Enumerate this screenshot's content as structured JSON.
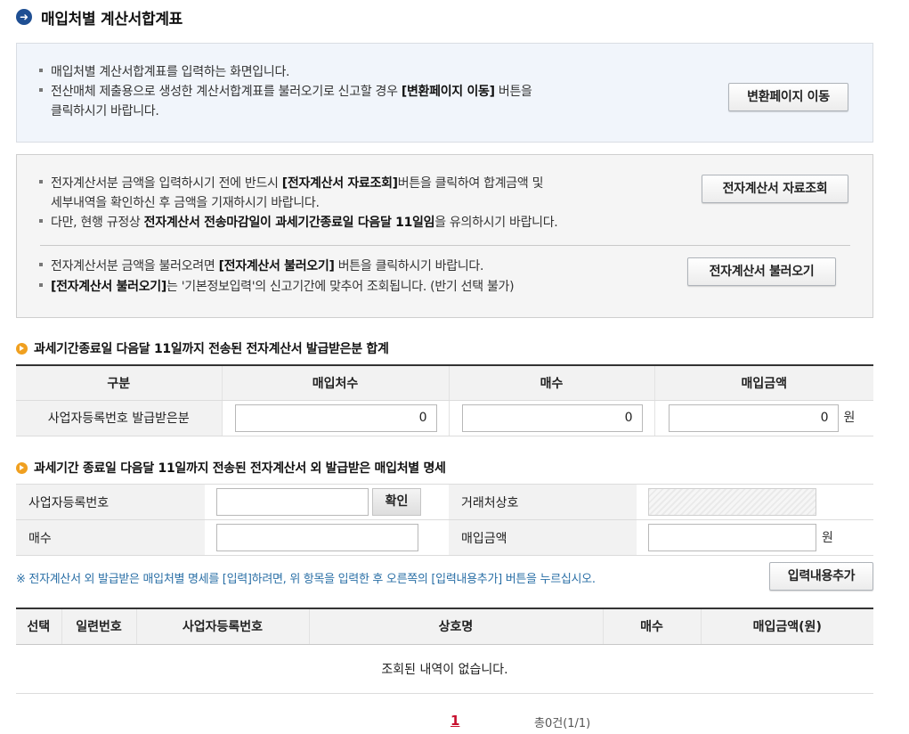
{
  "page": {
    "title": "매입처별 계산서합계표"
  },
  "box1": {
    "line1": "매입처별 계산서합계표를 입력하는 화면입니다.",
    "line2_pre": "전산매체 제출용으로 생성한 계산서합계표를 불러오기로 신고할 경우 ",
    "line2_bold": "[변환페이지 이동]",
    "line2_post": " 버튼을",
    "line3": "클릭하시기 바랍니다.",
    "button": "변환페이지 이동"
  },
  "box2": {
    "line1_pre": "전자계산서분 금액을 입력하시기 전에 반드시 ",
    "line1_bold": "[전자계산서 자료조회]",
    "line1_post": "버튼을 클릭하여 합계금액 및",
    "line2": "세부내역을 확인하신 후 금액을 기재하시기 바랍니다.",
    "line3_pre": "다만, 현행 규정상 ",
    "line3_bold": "전자계산서 전송마감일이 과세기간종료일 다음달 11일임",
    "line3_post": "을 유의하시기 바랍니다.",
    "button1": "전자계산서 자료조회",
    "line4_pre": "전자계산서분 금액을 불러오려면 ",
    "line4_bold": "[전자계산서 불러오기]",
    "line4_post": " 버튼을 클릭하시기 바랍니다.",
    "line5_bold": "[전자계산서 불러오기]",
    "line5_post": "는 '기본정보입력'의 신고기간에 맞추어 조회됩니다. (반기 선택 불가)",
    "button2": "전자계산서 불러오기"
  },
  "section1": {
    "title": "과세기간종료일 다음달 11일까지 전송된 전자계산서 발급받은분 합계",
    "headers": [
      "구분",
      "매입처수",
      "매수",
      "매입금액"
    ],
    "row_label": "사업자등록번호 발급받은분",
    "buyer_count": "0",
    "sheet_count": "0",
    "amount": "0",
    "unit": "원"
  },
  "section2": {
    "title": "과세기간 종료일 다음달 11일까지 전송된 전자계산서 외 발급받은 매입처별 명세",
    "biz_no_label": "사업자등록번호",
    "confirm_button": "확인",
    "trade_name_label": "거래처상호",
    "count_label": "매수",
    "amount_label": "매입금액",
    "unit": "원",
    "note": "※ 전자계산서 외 발급받은 매입처별 명세를 [입력]하려면, 위 항목을 입력한 후 오른쪽의 [입력내용추가] 버튼을 누르십시오.",
    "add_button": "입력내용추가"
  },
  "list": {
    "headers": [
      "선택",
      "일련번호",
      "사업자등록번호",
      "상호명",
      "매수",
      "매입금액(원)"
    ],
    "empty_message": "조회된 내역이 없습니다."
  },
  "pager": {
    "current_page": "1",
    "total": "총0건(1/1)"
  }
}
